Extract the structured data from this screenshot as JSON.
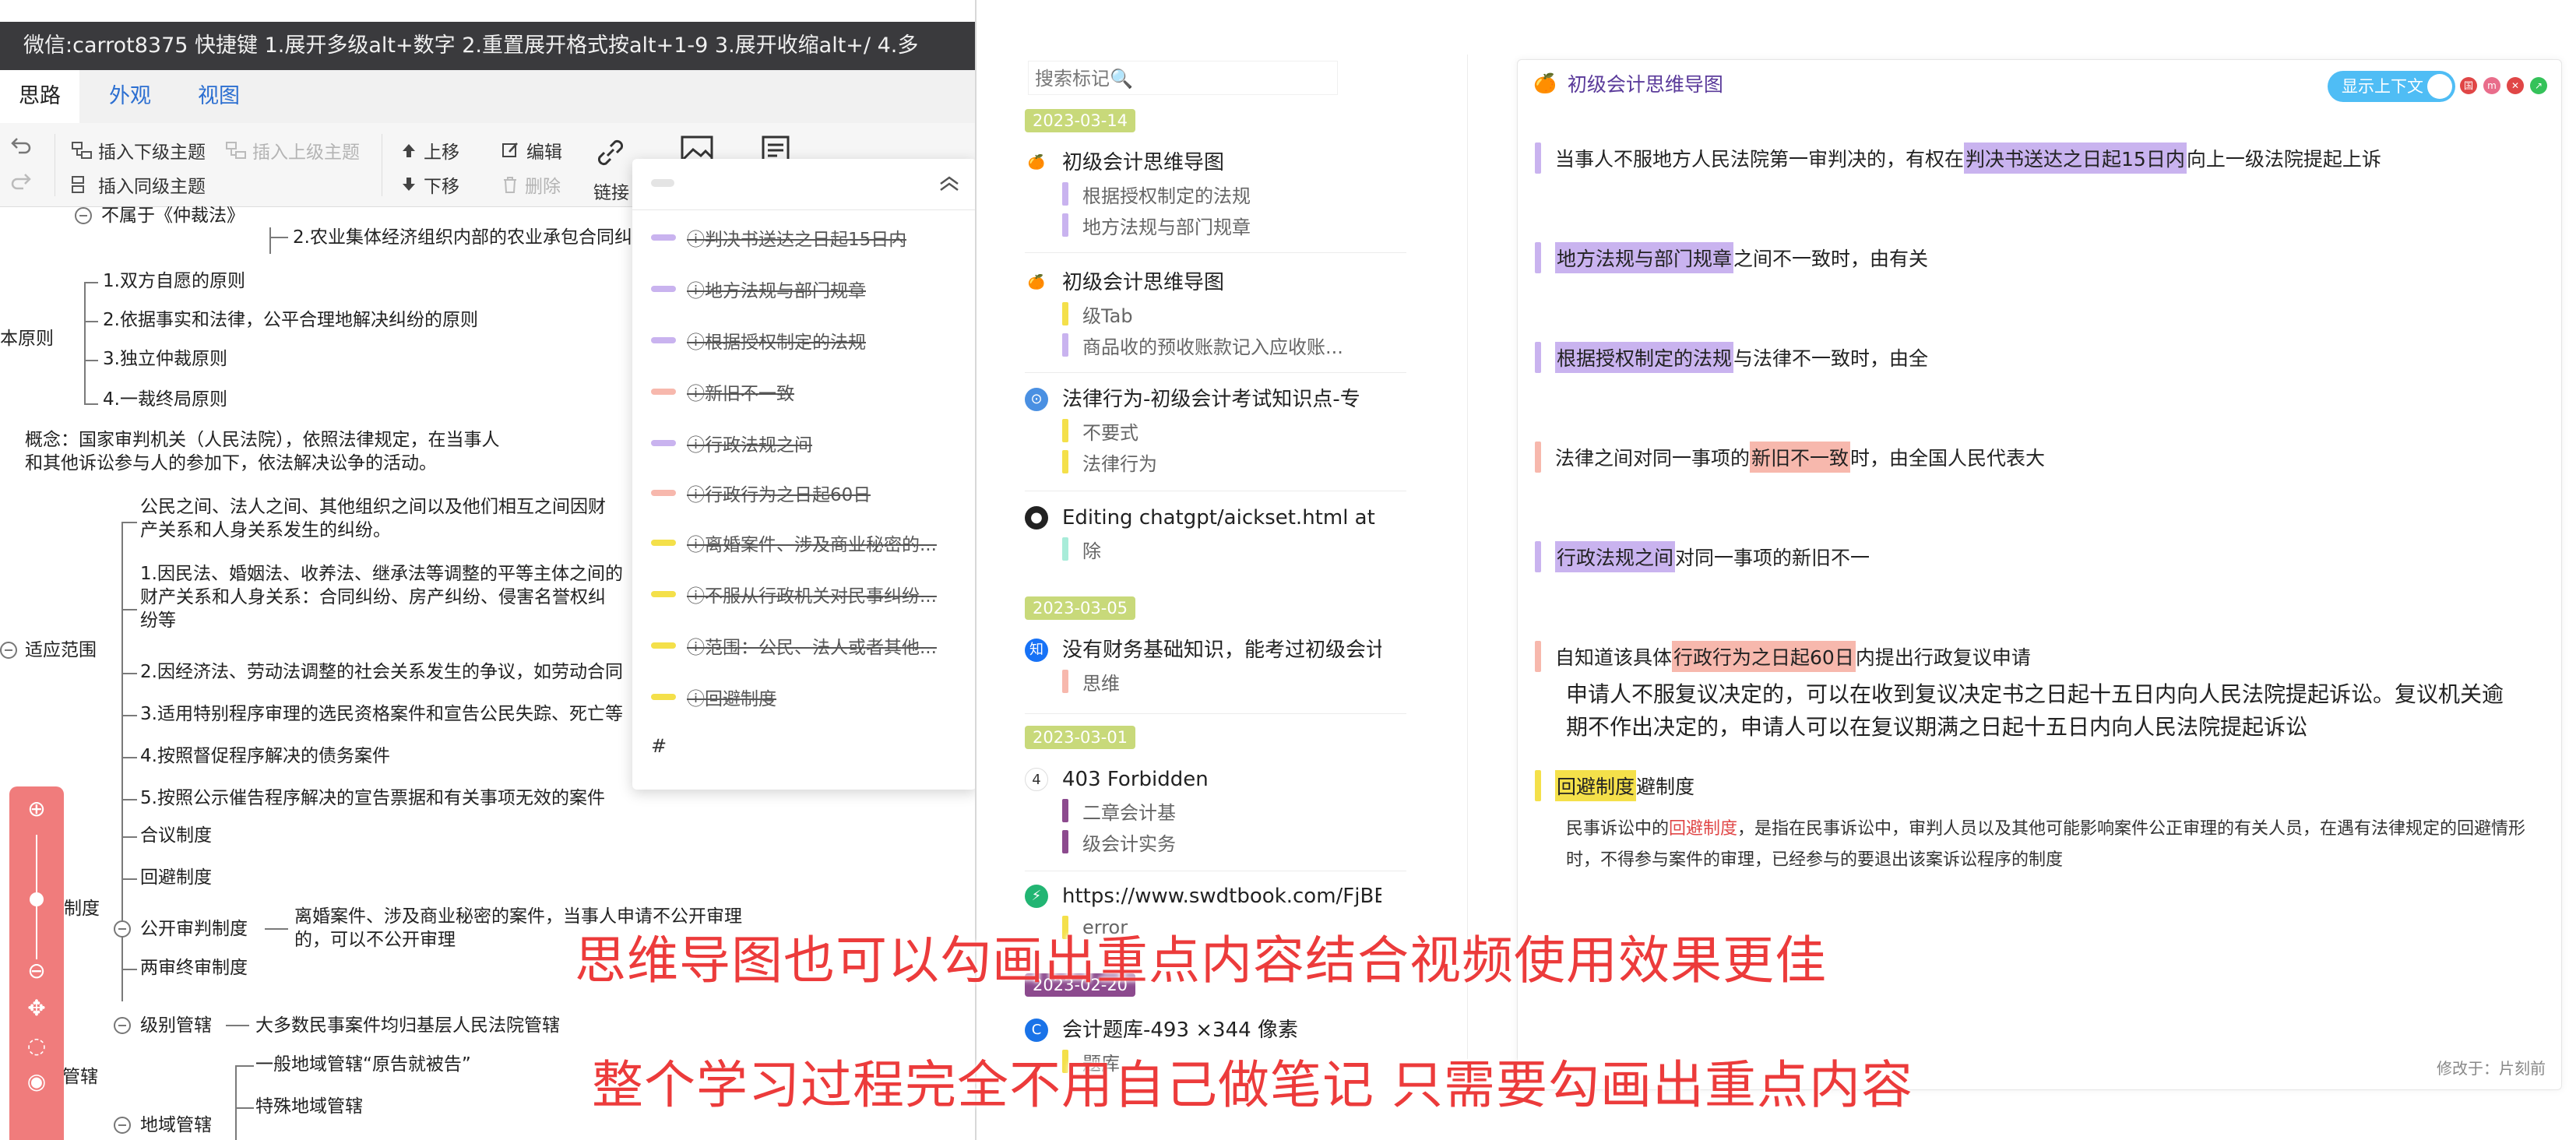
{
  "mindmap": {
    "title_bar": "微信:carrot8375 快捷键 1.展开多级alt+数字 2.重置展开格式按alt+1-9 3.展开收缩alt+/ 4.多",
    "menu_tabs": [
      "思路",
      "外观",
      "视图"
    ],
    "toolbar": {
      "insert_child": "插入下级主题",
      "insert_parent": "插入上级主题",
      "insert_sibling": "插入同级主题",
      "move_up": "上移",
      "move_down": "下移",
      "edit": "编辑",
      "delete": "删除",
      "link": "链接"
    },
    "nodes": {
      "n_not_belong": "不属于《仲裁法》",
      "n_rural": "2.农业集体经济组织内部的农业承包合同纠",
      "n_basic_principle": "本原则",
      "p1": "1.双方自愿的原则",
      "p2": "2.依据事实和法律，公平合理地解决纠纷的原则",
      "p3": "3.独立仲裁原则",
      "p4": "4.一裁终局原则",
      "concept": "概念：国家审判机关（人民法院），依照法律规定，在当事人和其他诉讼参与人的参加下，依法解决讼争的活动。",
      "scope": "适应范围",
      "s0": "公民之间、法人之间、其他组织之间以及他们相互之间因财产关系和人身关系发生的纠纷。",
      "s1": "1.因民法、婚姻法、收养法、继承法等调整的平等主体之间的财产关系和人身关系：合同纠纷、房产纠纷、侵害名誉权纠纷等",
      "s2": "2.因经济法、劳动法调整的社会关系发生的争议，如劳动合同",
      "s3": "3.适用特别程序审理的选民资格案件和宣告公民失踪、死亡等",
      "s4": "4.按照督促程序解决的债务案件",
      "s5": "5.按照公示催告程序解决的宣告票据和有关事项无效的案件",
      "system": "制度",
      "sys1": "合议制度",
      "sys2": "回避制度",
      "sys3": "公开审判制度",
      "sys3_detail": "离婚案件、涉及商业秘密的案件，当事人申请不公开审理的，可以不公开审理",
      "sys4": "两审终审制度",
      "jurisdiction": "管辖",
      "j1": "级别管辖",
      "j1_detail": "大多数民事案件均归基层人民法院管辖",
      "j2": "地域管辖",
      "j2a": "一般地域管辖“原告就被告”",
      "j2b": "特殊地域管辖"
    },
    "highlights_popup": {
      "items": [
        {
          "text": "ⓘ判决书送达之日起15日内",
          "color": "#c9b3ef"
        },
        {
          "text": "ⓘ地方法规与部门规章",
          "color": "#c9b3ef"
        },
        {
          "text": "ⓘ根据授权制定的法规",
          "color": "#c9b3ef"
        },
        {
          "text": "ⓘ新旧不一致",
          "color": "#f7b8ad"
        },
        {
          "text": "ⓘ行政法规之间",
          "color": "#c9b3ef"
        },
        {
          "text": "ⓘ行政行为之日起60日",
          "color": "#f7b8ad"
        },
        {
          "text": "ⓘ离婚案件、涉及商业秘密的...",
          "color": "#f4e04a"
        },
        {
          "text": "ⓘ不服从行政机关对民事纠纷...",
          "color": "#f4e04a"
        },
        {
          "text": "ⓘ范围：公民、法人或者其他...",
          "color": "#f4e04a"
        },
        {
          "text": "ⓘ回避制度",
          "color": "#f4e04a"
        }
      ],
      "hash": "#"
    }
  },
  "notes": {
    "search_placeholder": "搜索标记🔍",
    "groups": [
      {
        "date": "2023-03-14",
        "date_color": "#c8d97a"
      },
      {
        "date": "2023-03-05",
        "date_color": "#c8d97a"
      },
      {
        "date": "2023-03-01",
        "date_color": "#c8d97a"
      },
      {
        "date": "2023-02-20",
        "date_color": "#8c4a8e"
      }
    ],
    "items": [
      {
        "icon": "🍊",
        "icon_name": "fruit-icon",
        "title": "初级会计思维导图",
        "subs": [
          {
            "t": "根据授权制定的法规",
            "c": "#c9b3ef"
          },
          {
            "t": "地方法规与部门规章",
            "c": "#c9b3ef"
          }
        ]
      },
      {
        "icon": "🍊",
        "icon_name": "fruit-icon",
        "title": "初级会计思维导图",
        "subs": [
          {
            "t": "级Tab",
            "c": "#f4e04a"
          },
          {
            "t": "商品收的预收账款记入应收账...",
            "c": "#c9b3ef"
          }
        ]
      },
      {
        "icon": "⊙",
        "icon_name": "browser-icon",
        "title": "法律行为-初级会计考试知识点-专",
        "subs": [
          {
            "t": "不要式",
            "c": "#f4e04a"
          },
          {
            "t": "法律行为",
            "c": "#f4e04a"
          }
        ]
      },
      {
        "icon": "●",
        "icon_name": "github-icon",
        "title": "Editing chatgpt/aickset.html at r",
        "subs": [
          {
            "t": "除",
            "c": "#a8ecd9"
          }
        ]
      },
      {
        "icon": "知",
        "icon_name": "zhihu-icon",
        "title": "没有财务基础知识，能考过初级会计",
        "subs": [
          {
            "t": "思维",
            "c": "#f7b8ad"
          }
        ]
      },
      {
        "icon": "4",
        "icon_name": "forbidden-icon",
        "title": "403 Forbidden",
        "subs": [
          {
            "t": "二章会计基",
            "c": "#8c4a8e"
          },
          {
            "t": "级会计实务",
            "c": "#8c4a8e"
          }
        ]
      },
      {
        "icon": "⚡",
        "icon_name": "bolt-icon",
        "title": "https://www.swdtbook.com/FjBE",
        "subs": [
          {
            "t": "error",
            "c": "#f4e04a"
          }
        ]
      },
      {
        "icon": "C",
        "icon_name": "c-logo-icon",
        "title": "会计题库-493 ×344 像素",
        "subs": [
          {
            "t": "题库",
            "c": "#f4e04a"
          }
        ]
      }
    ]
  },
  "detail": {
    "title": "初级会计思维导图",
    "context_toggle": "显示上下文",
    "window_buttons": [
      {
        "label": "国",
        "color": "#e04646"
      },
      {
        "label": "m",
        "color": "#e96d8b"
      },
      {
        "label": "✕",
        "color": "#e04646"
      },
      {
        "label": "↗",
        "color": "#35c25a"
      }
    ],
    "h1_pre": "当事人不服地方人民法院第一审判决的，有权在",
    "h1_em": "判决书送达之日起15日内",
    "h1_post": "向上一级法院提起上诉",
    "h2_em": "地方法规与部门规章",
    "h2_post": "之间不一致时，由有关",
    "h3_em": "根据授权制定的法规",
    "h3_post": "与法律不一致时，由全",
    "h4_pre": "法律之间对同一事项的",
    "h4_em": "新旧不一致",
    "h4_post": "时，由全国人民代表大",
    "h5_em": "行政法规之间",
    "h5_post": "对同一事项的新旧不一",
    "h6_pre": "自知道该具体",
    "h6_em": "行政行为之日起60日",
    "h6_post": "内提出行政复议申请",
    "p6": "申请人不服复议决定的，可以在收到复议决定书之日起十五日内向人民法院提起诉讼。复议机关逾期不作出决定的，申请人可以在复议期满之日起十五日内向人民法院提起诉讼",
    "h7_em": "回避制度",
    "h7_post": "避制度",
    "p7_pre": "民事诉讼中的",
    "p7_red": "回避制度",
    "p7_post": "，是指在民事诉讼中，审判人员以及其他可能影响案件公正审理的有关人员，在遇有法律规定的回避情形时，不得参与案件的审理，已经参与的要退出该案诉讼程序的制度",
    "modified": "修改于：片刻前",
    "colors": {
      "purple": "#c9b3ef",
      "salmon": "#f7b8ad",
      "yellow": "#f4e04a"
    }
  },
  "captions": {
    "line1": "思维导图也可以勾画出重点内容结合视频使用效果更佳",
    "line2": "整个学习过程完全不用自己做笔记 只需要勾画出重点内容"
  }
}
